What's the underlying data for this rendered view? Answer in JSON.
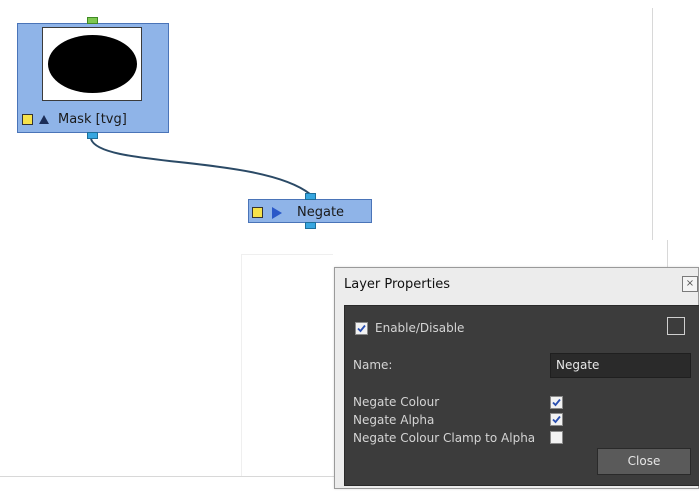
{
  "nodes": {
    "mask": {
      "label": "Mask [tvg]",
      "shape": "ellipse"
    },
    "negate": {
      "label": "Negate"
    }
  },
  "dialog": {
    "title": "Layer Properties",
    "close_icon": "×",
    "enable_label": "Enable/Disable",
    "enable_checked": true,
    "name_label": "Name:",
    "name_value": "Negate",
    "options": [
      {
        "label": "Negate Colour",
        "checked": true
      },
      {
        "label": "Negate Alpha",
        "checked": true
      },
      {
        "label": "Negate Colour Clamp to Alpha",
        "checked": false
      }
    ],
    "close_button": "Close"
  },
  "colors": {
    "node_fill": "#8fb4e8",
    "node_border": "#4a74b8",
    "panel_bg": "#3c3c3c",
    "port_green": "#7ec850",
    "port_blue": "#37a6e0",
    "wire": "#2b4a66"
  }
}
